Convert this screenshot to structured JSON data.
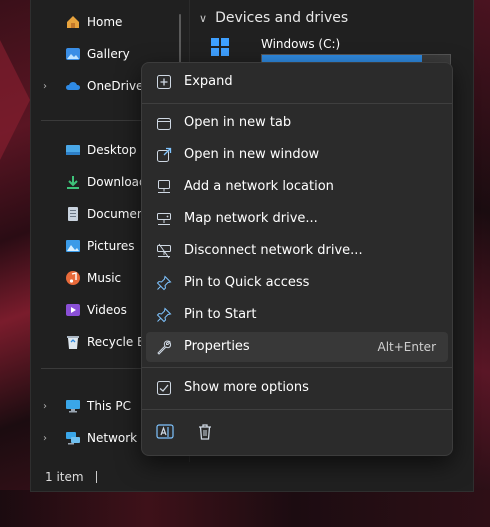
{
  "nav": {
    "items": [
      {
        "label": "Home",
        "expand": false
      },
      {
        "label": "Gallery",
        "expand": false
      },
      {
        "label": "OneDrive -",
        "expand": true
      },
      {
        "label": "Desktop",
        "expand": false
      },
      {
        "label": "Downloads",
        "expand": false
      },
      {
        "label": "Documents",
        "expand": false
      },
      {
        "label": "Pictures",
        "expand": false
      },
      {
        "label": "Music",
        "expand": false
      },
      {
        "label": "Videos",
        "expand": false
      },
      {
        "label": "Recycle Bin",
        "expand": false
      },
      {
        "label": "This PC",
        "expand": true
      },
      {
        "label": "Network",
        "expand": true
      }
    ]
  },
  "content": {
    "section_title": "Devices and drives",
    "drive": {
      "name": "Windows (C:)",
      "used_fraction": 0.85
    }
  },
  "status": {
    "text": "1 item"
  },
  "context_menu": {
    "items": [
      {
        "label": "Expand",
        "shortcut": "",
        "icon": "expand-icon"
      },
      {
        "label": "Open in new tab",
        "shortcut": "",
        "icon": "new-tab-icon"
      },
      {
        "label": "Open in new window",
        "shortcut": "",
        "icon": "new-window-icon"
      },
      {
        "label": "Add a network location",
        "shortcut": "",
        "icon": "network-location-icon"
      },
      {
        "label": "Map network drive...",
        "shortcut": "",
        "icon": "map-drive-icon"
      },
      {
        "label": "Disconnect network drive...",
        "shortcut": "",
        "icon": "disconnect-drive-icon"
      },
      {
        "label": "Pin to Quick access",
        "shortcut": "",
        "icon": "pin-icon"
      },
      {
        "label": "Pin to Start",
        "shortcut": "",
        "icon": "pin-start-icon"
      },
      {
        "label": "Properties",
        "shortcut": "Alt+Enter",
        "icon": "wrench-icon"
      },
      {
        "label": "Show more options",
        "shortcut": "",
        "icon": "more-options-icon"
      }
    ],
    "bottom_icons": [
      "rename-icon",
      "delete-icon"
    ]
  },
  "colors": {
    "accent": "#4cc2ff",
    "drive_bar": "#2f8ae0",
    "menu_bg": "#2b2b2b"
  }
}
